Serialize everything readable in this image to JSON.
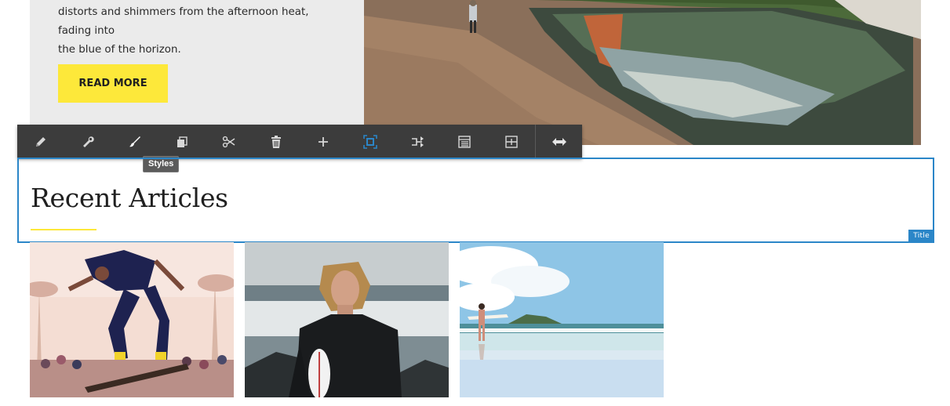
{
  "teaser": {
    "text_lines": [
      "distorts and shimmers from the afternoon heat, fading into",
      "the blue of the horizon."
    ],
    "button_label": "READ MORE"
  },
  "toolbar": {
    "items": [
      {
        "icon": "pencil-icon",
        "label": "Edit"
      },
      {
        "icon": "wrench-icon",
        "label": "Configure"
      },
      {
        "icon": "brush-icon",
        "label": "Styles"
      },
      {
        "icon": "copy-icon",
        "label": "Copy"
      },
      {
        "icon": "scissors-icon",
        "label": "Cut"
      },
      {
        "icon": "trash-icon",
        "label": "Delete"
      },
      {
        "icon": "plus-icon",
        "label": "Insert"
      },
      {
        "icon": "select-frame-icon",
        "label": "Select"
      },
      {
        "icon": "group-icon",
        "label": "Group"
      },
      {
        "icon": "layout-list-icon",
        "label": "Layout"
      },
      {
        "icon": "layout-split-icon",
        "label": "Columns"
      },
      {
        "icon": "horizontal-arrows-icon",
        "label": "Resize"
      }
    ],
    "tooltip": "Styles",
    "highlight_color": "#2b86c8"
  },
  "section": {
    "title": "Recent Articles",
    "component_label": "Title",
    "accent_color": "#fde83a",
    "frame_color": "#2b86c8"
  },
  "articles": [
    {
      "image": "skateboarder-jumping-photo"
    },
    {
      "image": "surfer-in-wetsuit-photo"
    },
    {
      "image": "surfer-on-beach-photo"
    }
  ]
}
